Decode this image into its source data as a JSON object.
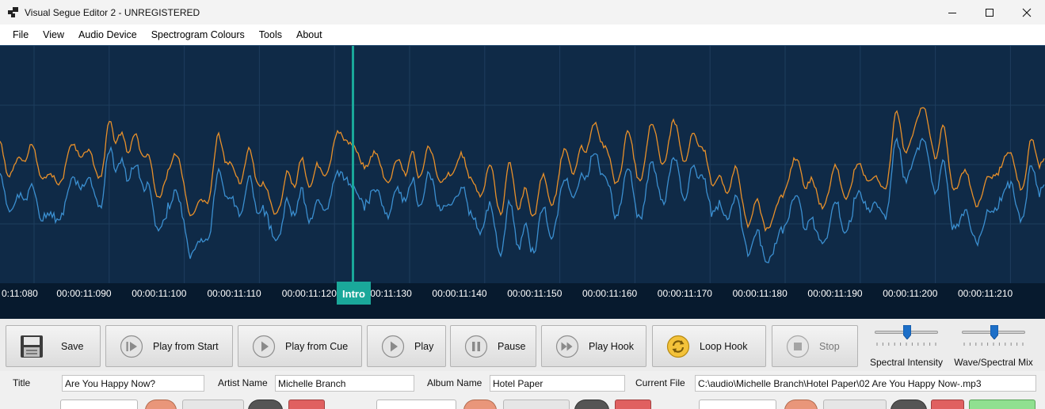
{
  "window": {
    "title": "Visual Segue Editor 2 - UNREGISTERED",
    "minimize_icon": "minimize-icon",
    "maximize_icon": "maximize-icon",
    "close_icon": "close-icon"
  },
  "menu": [
    "File",
    "View",
    "Audio Device",
    "Spectrogram Colours",
    "Tools",
    "About"
  ],
  "waveform": {
    "time_labels": [
      "0:11:080",
      "00:00:11:090",
      "00:00:11:100",
      "00:00:11:110",
      "00:00:11:120",
      "00:00:11:130",
      "00:00:11:140",
      "00:00:11:150",
      "00:00:11:160",
      "00:00:11:170",
      "00:00:11:180",
      "00:00:11:190",
      "00:00:11:200",
      "00:00:11:210"
    ],
    "marker_label": "Intro",
    "colors": {
      "background": "#0f2a47",
      "channel_left": "#e8902a",
      "channel_right": "#3b8fd0",
      "marker": "#1aa89a",
      "axis": "#071a2e"
    }
  },
  "toolbar": {
    "save": "Save",
    "play_from_start": "Play from Start",
    "play_from_cue": "Play from Cue",
    "play": "Play",
    "pause": "Pause",
    "play_hook": "Play Hook",
    "loop_hook": "Loop Hook",
    "stop": "Stop",
    "spectral_intensity": "Spectral Intensity",
    "wave_spectral_mix": "Wave/Spectral Mix",
    "spectral_intensity_value": 0.52,
    "wave_spectral_mix_value": 0.52
  },
  "meta": {
    "title_label": "Title",
    "title_value": "Are You Happy Now?",
    "artist_label": "Artist Name",
    "artist_value": "Michelle Branch",
    "album_label": "Album Name",
    "album_value": "Hotel Paper",
    "file_label": "Current File",
    "file_value": "C:\\audio\\Michelle Branch\\Hotel Paper\\02 Are You Happy Now-.mp3"
  }
}
